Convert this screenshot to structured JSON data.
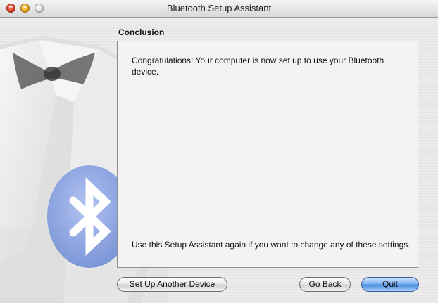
{
  "window": {
    "title": "Bluetooth Setup Assistant"
  },
  "section": {
    "heading": "Conclusion"
  },
  "message": {
    "congrats": "Congratulations! Your computer is now set up to use your Bluetooth device.",
    "hint": "Use this Setup Assistant again if you want to change any of these settings."
  },
  "buttons": {
    "setup_another": "Set Up Another Device",
    "go_back": "Go Back",
    "quit": "Quit"
  },
  "colors": {
    "accent": "#4a8be0",
    "bluetooth_badge": "#6f8fd8"
  },
  "icons": {
    "art": "tuxedo-bowtie-illustration",
    "badge": "bluetooth-icon"
  }
}
